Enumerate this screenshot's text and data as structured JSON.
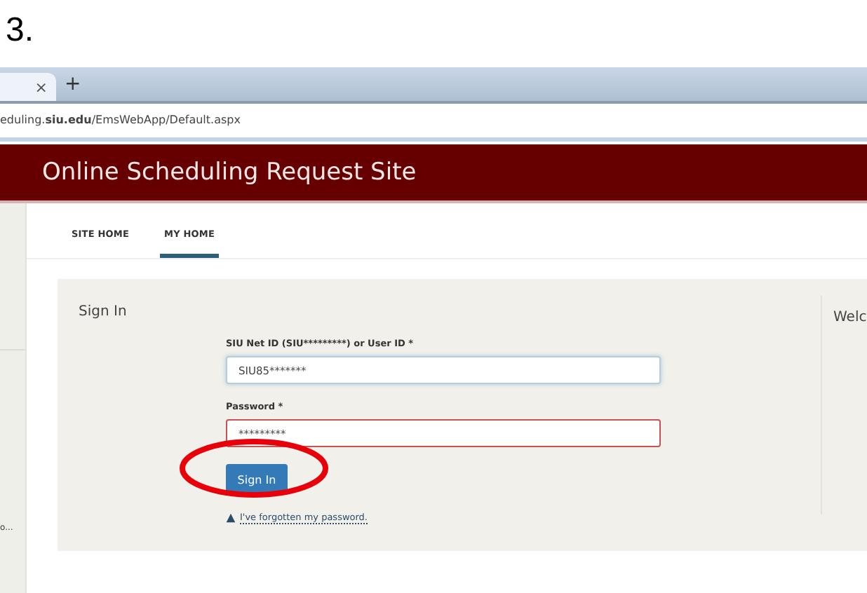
{
  "step_label": "3.",
  "browser": {
    "tab_close": "×",
    "new_tab": "+",
    "address": "eduling.**siu.edu**/EmsWebApp/Default.aspx"
  },
  "header": {
    "title": "Online Scheduling Request Site"
  },
  "sidebar": {
    "text": "o..."
  },
  "tabs": [
    {
      "label": "SITE HOME",
      "selected": false
    },
    {
      "label": "MY HOME",
      "selected": true
    }
  ],
  "sign_in": {
    "heading": "Sign In",
    "fields": [
      {
        "label": "SIU Net ID (SIU*********) or User ID *",
        "value": "SIU85*******",
        "focused": true,
        "invalid": false
      },
      {
        "label": "Password *",
        "value": "*********",
        "focused": false,
        "invalid": true
      }
    ],
    "button": "Sign In",
    "forgot_link": "I've forgotten my password.",
    "annotated": true
  },
  "welcome": {
    "heading": "Welc"
  }
}
